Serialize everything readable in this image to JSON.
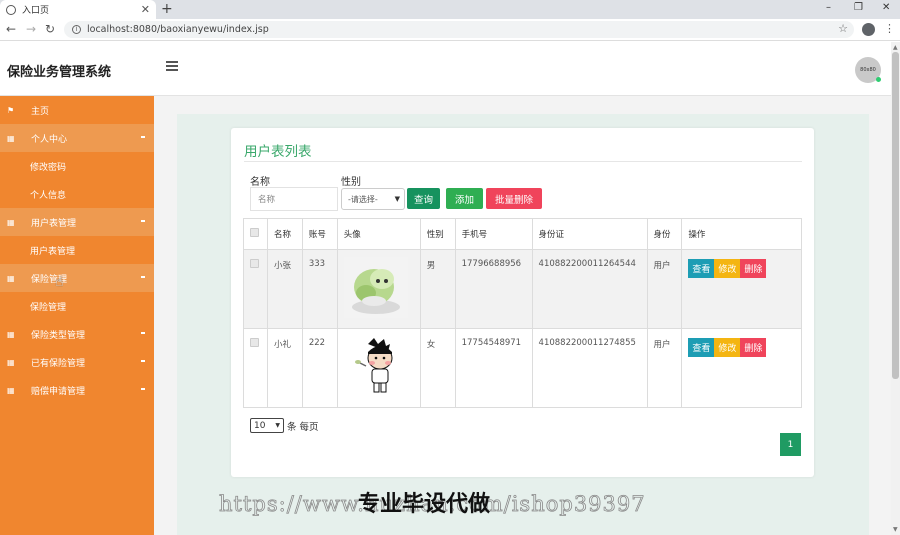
{
  "browser": {
    "tab_title": "入口页",
    "tab_close": "✕",
    "new_tab": "+",
    "url": "localhost:8080/baoxianyewu/index.jsp",
    "win_min": "–",
    "win_max": "❐",
    "win_close": "✕"
  },
  "header": {
    "brand": "保险业务管理系统",
    "avatar_text": "80x80"
  },
  "sidebar": {
    "items": [
      {
        "label": "主页",
        "icon": "flag-icon"
      },
      {
        "label": "个人中心",
        "icon": "grid-icon"
      },
      {
        "label": "修改密码"
      },
      {
        "label": "个人信息"
      },
      {
        "label": "用户表管理",
        "icon": "grid-icon"
      },
      {
        "label": "用户表管理"
      },
      {
        "label": "保险管理",
        "icon": "grid-icon"
      },
      {
        "label": "保险管理"
      },
      {
        "label": "保险类型管理",
        "icon": "grid-icon"
      },
      {
        "label": "已有保险管理",
        "icon": "grid-icon"
      },
      {
        "label": "赔偿申请管理",
        "icon": "grid-icon"
      }
    ]
  },
  "main": {
    "title": "用户表列表",
    "search": {
      "name_label": "名称",
      "name_placeholder": "名称",
      "gender_label": "性别",
      "gender_selected": "-请选择-"
    },
    "buttons": {
      "query": "查询",
      "add": "添加",
      "batch_delete": "批量删除"
    },
    "table": {
      "headers": [
        "",
        "名称",
        "账号",
        "头像",
        "性别",
        "手机号",
        "身份证",
        "身份",
        "操作"
      ],
      "rows": [
        {
          "name": "小张",
          "account": "333",
          "gender": "男",
          "phone": "17796688956",
          "id_card": "410882200011264544",
          "role": "用户"
        },
        {
          "name": "小礼",
          "account": "222",
          "gender": "女",
          "phone": "17754548971",
          "id_card": "410882200011274855",
          "role": "用户"
        }
      ],
      "actions": {
        "view": "查看",
        "edit": "修改",
        "delete": "删除"
      }
    },
    "pagination": {
      "page_size": "10",
      "page_size_suffix": "条 每页",
      "current_page": "1"
    }
  },
  "watermark": {
    "url_text": "https://www.huzhan.com/ishop39397",
    "cn_text": "专业毕设代做"
  },
  "colors": {
    "sidebar": "#f0862f",
    "accent_green": "#3aa86b",
    "btn_query": "#16925e",
    "btn_add": "#2fae52",
    "btn_delete": "#f0445b",
    "btn_view": "#1d9db4",
    "btn_edit": "#f4b512"
  }
}
